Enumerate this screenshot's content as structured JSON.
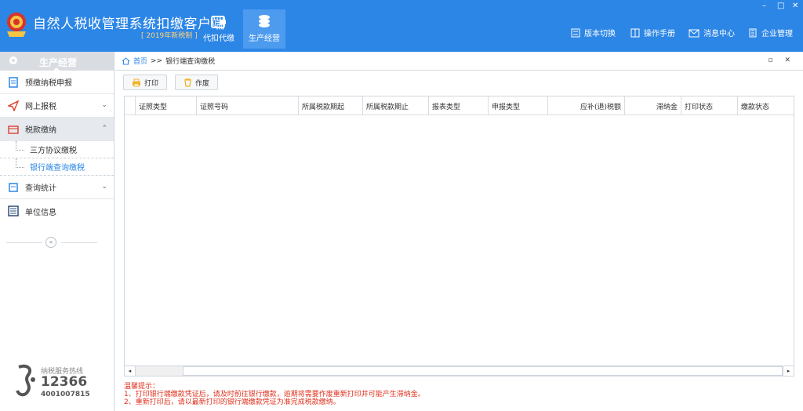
{
  "header": {
    "app_title": "自然人税收管理系统扣缴客户端",
    "app_subtitle": "[ 2019年新税制 ]",
    "nav": [
      {
        "label": "代扣代缴",
        "icon": "wallet-icon"
      },
      {
        "label": "生产经营",
        "icon": "coins-icon"
      }
    ],
    "right_menu": [
      {
        "label": "版本切换",
        "icon": "switch-icon"
      },
      {
        "label": "操作手册",
        "icon": "manual-icon"
      },
      {
        "label": "消息中心",
        "icon": "mail-icon"
      },
      {
        "label": "企业管理",
        "icon": "building-icon"
      }
    ],
    "window_controls": {
      "minimize": "–",
      "maximize": "□",
      "close": "✕"
    }
  },
  "sidebar": {
    "title": "生产经营",
    "items": [
      {
        "label": "预缴纳税申报",
        "icon": "form-icon"
      },
      {
        "label": "网上报税",
        "icon": "send-icon",
        "chevron": "⌄"
      },
      {
        "label": "税款缴纳",
        "icon": "payment-icon",
        "chevron": "⌃"
      },
      {
        "label": "查询统计",
        "icon": "query-icon",
        "chevron": "⌄"
      },
      {
        "label": "单位信息",
        "icon": "list-icon"
      }
    ],
    "subitems": [
      {
        "label": "三方协议缴税"
      },
      {
        "label": "银行端查询缴税"
      }
    ],
    "collapse_label": "«",
    "hotline_label": "纳税服务热线",
    "hotline_number": "12366",
    "hotline_number2": "4001007815"
  },
  "main": {
    "breadcrumb_home": "首页",
    "breadcrumb_sep": ">>",
    "breadcrumb_current": "银行端查询缴税",
    "window_tools": "▫ ✕",
    "toolbar": {
      "print_label": "打印",
      "void_label": "作废"
    },
    "columns": [
      "证照类型",
      "证照号码",
      "所属税款期起",
      "所属税款期止",
      "报表类型",
      "申报类型",
      "应补(退)税额",
      "滞纳金",
      "打印状态",
      "缴款状态"
    ],
    "scroll_left": "◂",
    "scroll_right": "▸",
    "tips_title": "温馨提示：",
    "tips": [
      "1、打印银行端缴款凭证后，请及时前往银行缴款，逾期将需要作废重新打印并可能产生滞纳金。",
      "2、重新打印后，请以最新打印的银行端缴款凭证为准完成税款缴纳。"
    ]
  },
  "colors": {
    "header_blue": "#2c86e6",
    "accent": "#2c86e6",
    "tip_red": "#e0311e",
    "subtitle_orange": "#ffd27a"
  }
}
